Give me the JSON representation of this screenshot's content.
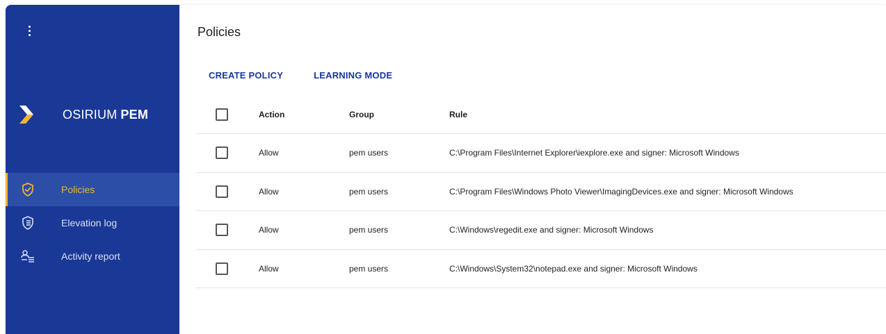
{
  "brand": {
    "name": "OSIRIUM",
    "product": "PEM"
  },
  "colors": {
    "sidebar": "#1a3896",
    "accent": "#f3b233",
    "primary": "#1a3896"
  },
  "nav": {
    "items": [
      {
        "label": "Policies",
        "icon": "shield-check-icon",
        "active": true
      },
      {
        "label": "Elevation log",
        "icon": "log-icon",
        "active": false
      },
      {
        "label": "Activity report",
        "icon": "user-list-icon",
        "active": false
      }
    ]
  },
  "page": {
    "title": "Policies"
  },
  "toolbar": {
    "create_label": "CREATE POLICY",
    "learning_label": "LEARNING MODE"
  },
  "table": {
    "headers": {
      "action": "Action",
      "group": "Group",
      "rule": "Rule"
    },
    "rows": [
      {
        "action": "Allow",
        "group": "pem users",
        "rule": "C:\\Program Files\\Internet Explorer\\iexplore.exe and signer: Microsoft Windows"
      },
      {
        "action": "Allow",
        "group": "pem users",
        "rule": "C:\\Program Files\\Windows Photo Viewer\\ImagingDevices.exe and signer: Microsoft Windows"
      },
      {
        "action": "Allow",
        "group": "pem users",
        "rule": "C:\\Windows\\regedit.exe and signer: Microsoft Windows"
      },
      {
        "action": "Allow",
        "group": "pem users",
        "rule": "C:\\Windows\\System32\\notepad.exe and signer: Microsoft Windows"
      }
    ]
  }
}
